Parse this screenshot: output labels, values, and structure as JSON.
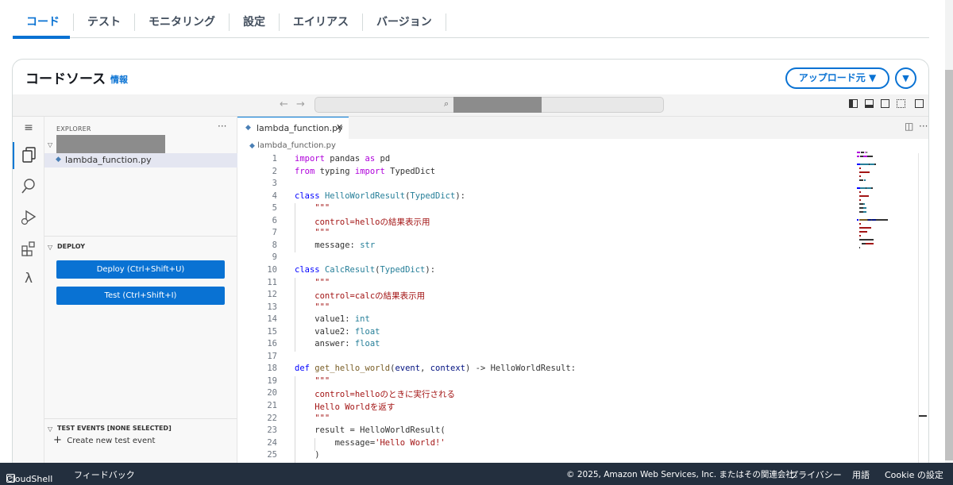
{
  "tabs": [
    {
      "label": "コード"
    },
    {
      "label": "テスト"
    },
    {
      "label": "モニタリング"
    },
    {
      "label": "設定"
    },
    {
      "label": "エイリアス"
    },
    {
      "label": "バージョン"
    }
  ],
  "card": {
    "title": "コードソース",
    "info": "情報",
    "upload_button": "アップロード元 ▼"
  },
  "explorer": {
    "header": "EXPLORER",
    "file": "lambda_function.py",
    "deploy_section": "DEPLOY",
    "deploy_button": "Deploy (Ctrl+Shift+U)",
    "test_button": "Test (Ctrl+Shift+I)",
    "test_events_section": "TEST EVENTS [NONE SELECTED]",
    "create_event": "Create new test event"
  },
  "editor": {
    "tab_name": "lambda_function.py",
    "breadcrumb": "lambda_function.py",
    "lines": [
      [
        [
          "import",
          "k"
        ],
        [
          " pandas ",
          "t"
        ],
        [
          "as",
          "k"
        ],
        [
          " pd",
          "t"
        ]
      ],
      [
        [
          "from",
          "k"
        ],
        [
          " typing ",
          "t"
        ],
        [
          "import",
          "k"
        ],
        [
          " TypedDict",
          "t"
        ]
      ],
      [],
      [
        [
          "class",
          "b"
        ],
        [
          " ",
          "t"
        ],
        [
          "HelloWorldResult",
          "c"
        ],
        [
          "(",
          "t"
        ],
        [
          "TypedDict",
          "c"
        ],
        [
          "):",
          "t"
        ]
      ],
      [
        [
          "    \"\"\"",
          "s"
        ]
      ],
      [
        [
          "    control=helloの結果表示用",
          "s"
        ]
      ],
      [
        [
          "    \"\"\"",
          "s"
        ]
      ],
      [
        [
          "    message: ",
          "t"
        ],
        [
          "str",
          "c"
        ]
      ],
      [],
      [
        [
          "class",
          "b"
        ],
        [
          " ",
          "t"
        ],
        [
          "CalcResult",
          "c"
        ],
        [
          "(",
          "t"
        ],
        [
          "TypedDict",
          "c"
        ],
        [
          "):",
          "t"
        ]
      ],
      [
        [
          "    \"\"\"",
          "s"
        ]
      ],
      [
        [
          "    control=calcの結果表示用",
          "s"
        ]
      ],
      [
        [
          "    \"\"\"",
          "s"
        ]
      ],
      [
        [
          "    value1: ",
          "t"
        ],
        [
          "int",
          "c"
        ]
      ],
      [
        [
          "    value2: ",
          "t"
        ],
        [
          "float",
          "c"
        ]
      ],
      [
        [
          "    answer: ",
          "t"
        ],
        [
          "float",
          "c"
        ]
      ],
      [],
      [
        [
          "def",
          "b"
        ],
        [
          " ",
          "t"
        ],
        [
          "get_hello_world",
          "f"
        ],
        [
          "(",
          "t"
        ],
        [
          "event",
          "p"
        ],
        [
          ", ",
          "t"
        ],
        [
          "context",
          "p"
        ],
        [
          ") -> HelloWorldResult:",
          "t"
        ]
      ],
      [
        [
          "    \"\"\"",
          "s"
        ]
      ],
      [
        [
          "    control=helloのときに実行される",
          "s"
        ]
      ],
      [
        [
          "    Hello Worldを返す",
          "s"
        ]
      ],
      [
        [
          "    \"\"\"",
          "s"
        ]
      ],
      [
        [
          "    result = HelloWorldResult(",
          "t"
        ]
      ],
      [
        [
          "        message=",
          "t"
        ],
        [
          "'Hello World!'",
          "s"
        ]
      ],
      [
        [
          "    )",
          "t"
        ]
      ]
    ]
  },
  "colors": {
    "k": "#af00db",
    "b": "#0000ff",
    "c": "#267f99",
    "f": "#795e26",
    "p": "#001080",
    "s": "#a31515",
    "t": "#333333"
  },
  "footer": {
    "cloudshell": "CloudShell",
    "feedback": "フィードバック",
    "copyright": "© 2025, Amazon Web Services, Inc. またはその関連会社。",
    "privacy": "プライバシー",
    "terms": "用語",
    "cookie": "Cookie の設定"
  }
}
